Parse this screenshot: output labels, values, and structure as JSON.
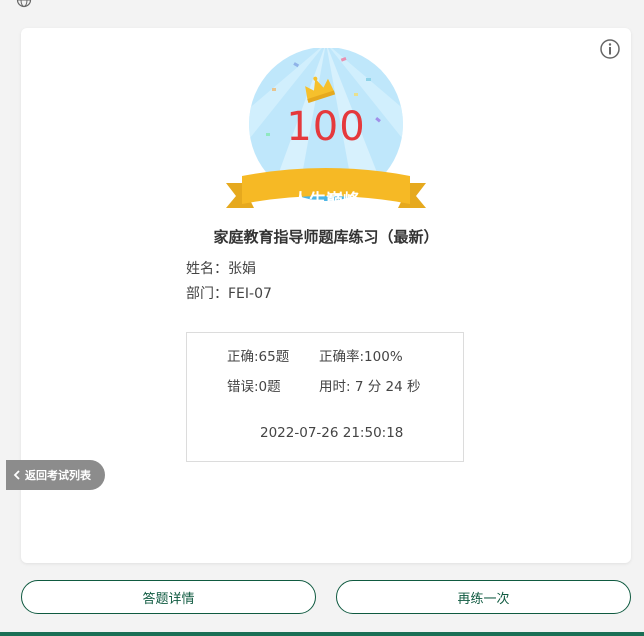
{
  "header": {
    "icon": "globe-icon"
  },
  "card": {
    "info_icon": "info-icon",
    "badge": {
      "score": "100",
      "ribbon_text": "人生巅峰"
    },
    "title": "家庭教育指导师题库练习（最新）",
    "name_line": "姓名：张娟",
    "department_line": "部门：FEI-07",
    "stats": {
      "correct": "正确:65题",
      "accuracy": "正确率:100%",
      "wrong": "错误:0题",
      "time_used": "用时: 7 分 24 秒",
      "timestamp": "2022-07-26 21:50:18"
    }
  },
  "back_button": {
    "label": "返回考试列表"
  },
  "actions": {
    "details_label": "答题详情",
    "retry_label": "再练一次"
  },
  "colors": {
    "accent": "#0f5a40",
    "score": "#e5393c",
    "ribbon": "#f6b925",
    "badge_sky": "#bfe7fb"
  }
}
